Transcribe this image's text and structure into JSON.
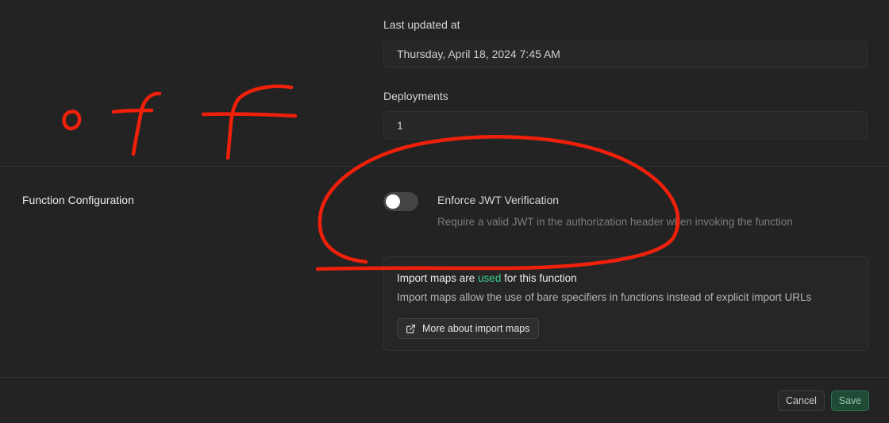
{
  "fields": {
    "last_updated": {
      "label": "Last updated at",
      "value": "Thursday, April 18, 2024 7:45 AM"
    },
    "deployments": {
      "label": "Deployments",
      "value": "1"
    }
  },
  "function_config": {
    "section_label": "Function Configuration",
    "jwt_toggle": {
      "title": "Enforce JWT Verification",
      "description": "Require a valid JWT in the authorization header when invoking the function",
      "enabled": false
    },
    "import_maps": {
      "title_prefix": "Import maps are ",
      "title_accent": "used",
      "title_suffix": " for this function",
      "description": "Import maps allow the use of bare specifiers in functions instead of explicit import URLs",
      "link_label": "More about import maps",
      "link_icon": "external-link-icon"
    }
  },
  "footer": {
    "cancel_label": "Cancel",
    "save_label": "Save"
  },
  "annotation": {
    "handwritten_text": "off",
    "color": "#f0200a"
  },
  "colors": {
    "background": "#232323",
    "accent": "#3ecf8e",
    "save_button": "#1f4a35"
  }
}
